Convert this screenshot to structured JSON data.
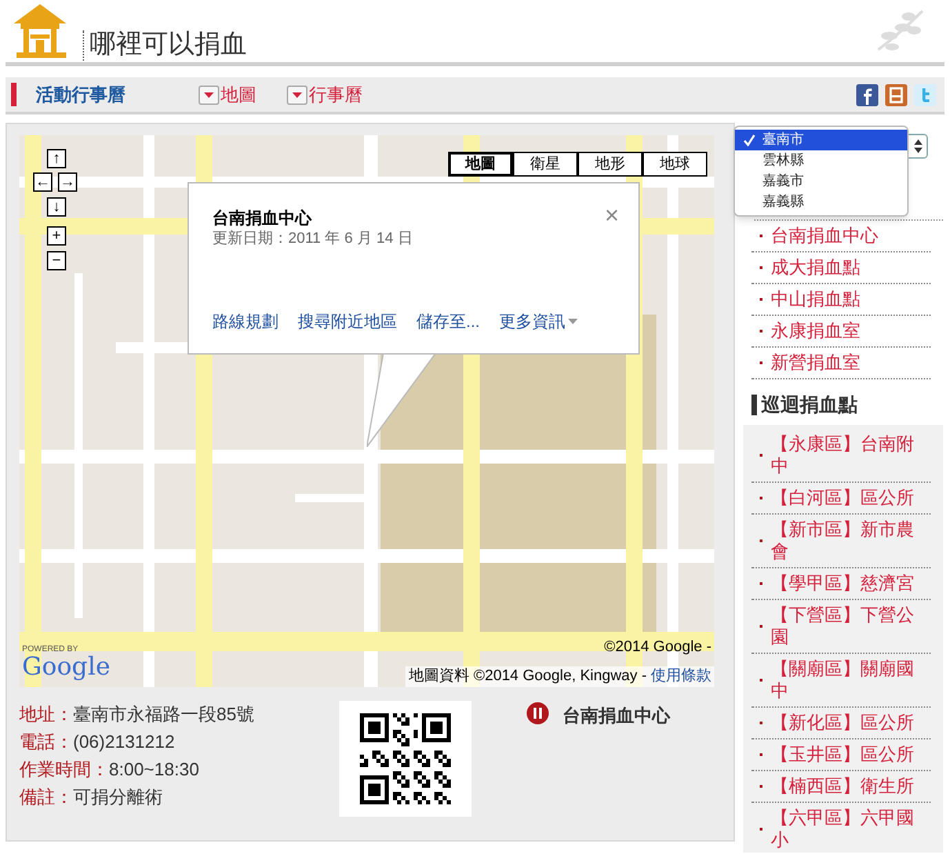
{
  "header": {
    "title": "哪裡可以捐血"
  },
  "nav": {
    "section": "活動行事曆",
    "links": [
      "地圖",
      "行事曆"
    ]
  },
  "map": {
    "nav_controls": [
      "↑",
      "←",
      "→",
      "↓",
      "+",
      "−"
    ],
    "type_buttons": [
      {
        "label": "地圖",
        "selected": true
      },
      {
        "label": "衛星",
        "selected": false
      },
      {
        "label": "地形",
        "selected": false
      },
      {
        "label": "地球",
        "selected": false
      }
    ],
    "info_window": {
      "title": "台南捐血中心",
      "updated": "更新日期：2011 年 6 月 14 日",
      "close": "×",
      "actions": [
        "路線規劃",
        "搜尋附近地區",
        "儲存至...",
        "更多資訊"
      ]
    },
    "logo_caption": "POWERED BY",
    "logo": "Google",
    "copyright": "©2014 Google -",
    "attribution": "地圖資料 ©2014 Google, Kingway -",
    "terms": "使用條款"
  },
  "details": [
    {
      "label": "地址：",
      "value": "臺南市永福路一段85號"
    },
    {
      "label": "電話：",
      "value": "(06)2131212"
    },
    {
      "label": "作業時間：",
      "value": "8:00~18:30"
    },
    {
      "label": "備註：",
      "value": "可捐分離術"
    }
  ],
  "place_name": "台南捐血中心",
  "sidebar": {
    "city_options": [
      {
        "label": "臺南市",
        "selected": true
      },
      {
        "label": "雲林縣",
        "selected": false
      },
      {
        "label": "嘉義市",
        "selected": false
      },
      {
        "label": "嘉義縣",
        "selected": false
      }
    ],
    "centers": [
      "台南捐血中心",
      "成大捐血點",
      "中山捐血點",
      "永康捐血室",
      "新營捐血室"
    ],
    "mobile_heading": "巡迴捐血點",
    "mobile_sites": [
      "【永康區】台南附中",
      "【白河區】區公所",
      "【新市區】新市農會",
      "【學甲區】慈濟宮",
      "【下營區】下營公園",
      "【關廟區】關廟國中",
      "【新化區】區公所",
      "【玉井區】區公所",
      "【楠西區】衛生所",
      "【六甲區】六甲國小"
    ]
  }
}
